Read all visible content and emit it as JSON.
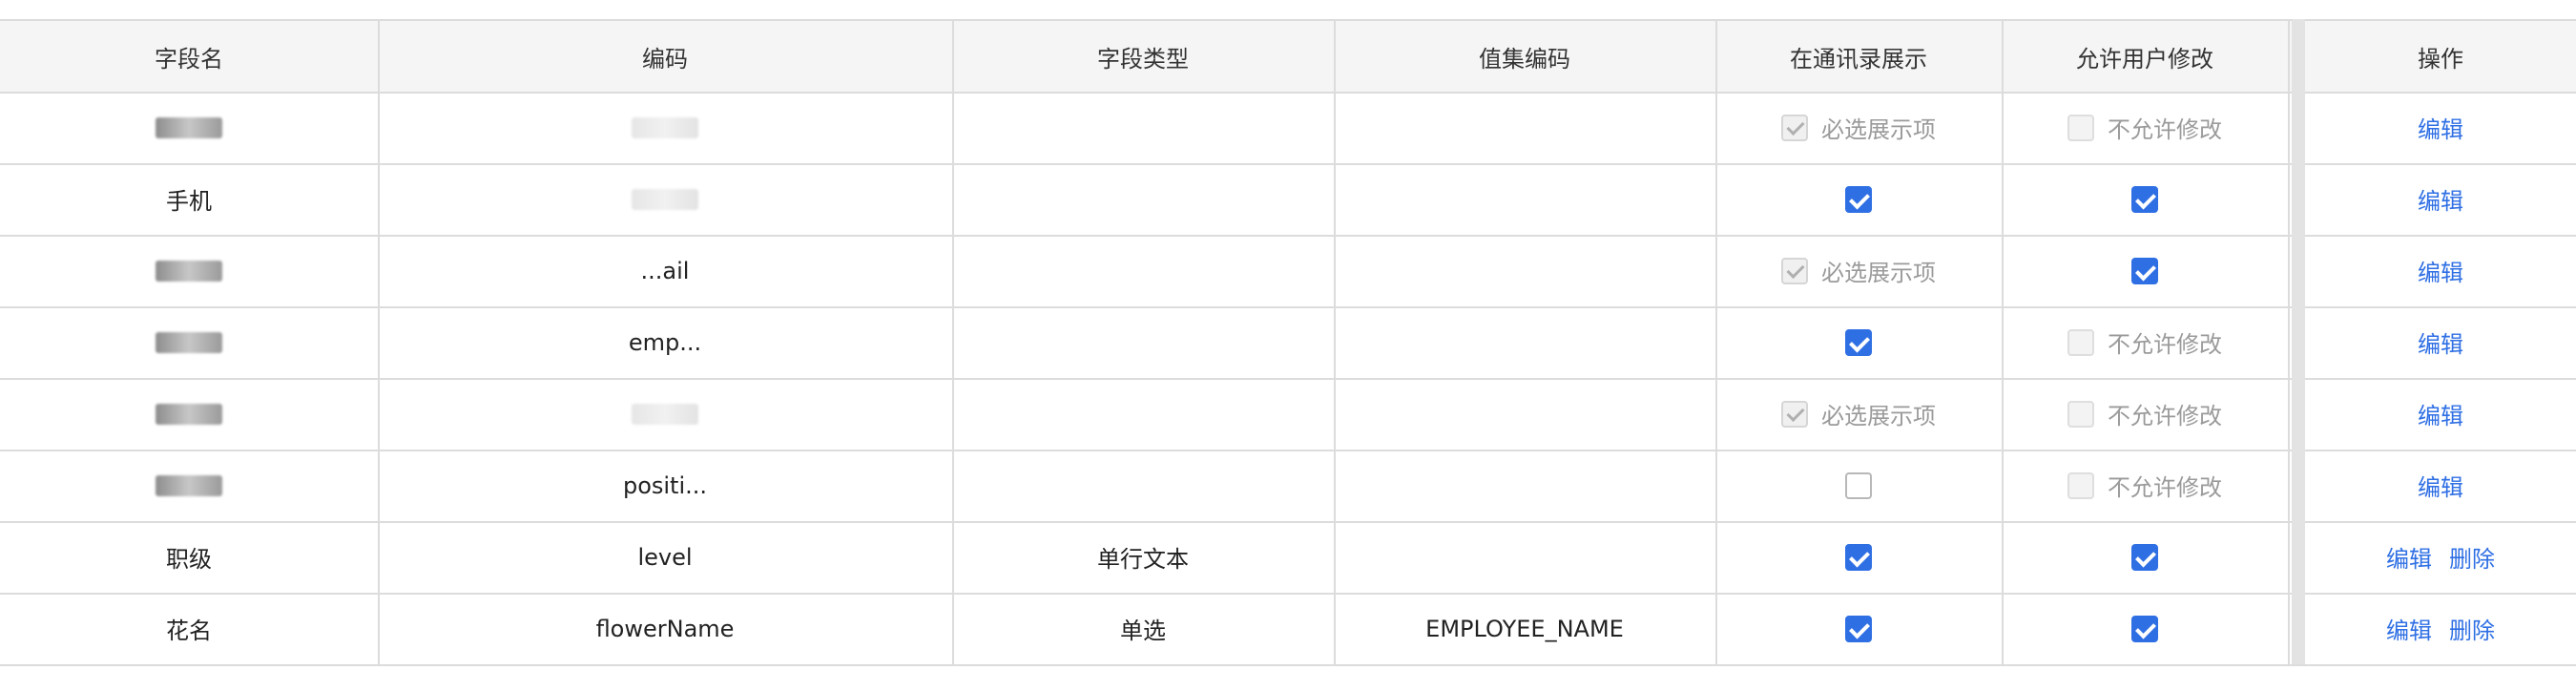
{
  "columns": [
    "字段名",
    "编码",
    "字段类型",
    "值集编码",
    "在通讯录展示",
    "允许用户修改",
    "操作"
  ],
  "labels": {
    "required_show": "必选展示项",
    "not_editable": "不允许修改",
    "edit": "编辑",
    "delete": "删除"
  },
  "rows": [
    {
      "name": "",
      "code": "",
      "type": "",
      "valueset": "",
      "show": "required",
      "modify": "disabled",
      "actions": [
        "编辑"
      ]
    },
    {
      "name": "手机",
      "code": "",
      "type": "",
      "valueset": "",
      "show": "checked",
      "modify": "checked",
      "actions": [
        "编辑"
      ]
    },
    {
      "name": "",
      "code": "...ail",
      "type": "",
      "valueset": "",
      "show": "required",
      "modify": "checked",
      "actions": [
        "编辑"
      ]
    },
    {
      "name": "",
      "code": "emp...",
      "type": "",
      "valueset": "",
      "show": "checked",
      "modify": "disabled",
      "actions": [
        "编辑"
      ]
    },
    {
      "name": "",
      "code": "",
      "type": "",
      "valueset": "",
      "show": "required",
      "modify": "disabled",
      "actions": [
        "编辑"
      ]
    },
    {
      "name": "",
      "code": "positi...",
      "type": "",
      "valueset": "",
      "show": "unchecked",
      "modify": "disabled",
      "actions": [
        "编辑"
      ]
    },
    {
      "name": "职级",
      "code": "level",
      "type": "单行文本",
      "valueset": "",
      "show": "checked",
      "modify": "checked",
      "actions": [
        "编辑",
        "删除"
      ]
    },
    {
      "name": "花名",
      "code": "flowerName",
      "type": "单选",
      "valueset": "EMPLOYEE_NAME",
      "show": "checked",
      "modify": "checked",
      "actions": [
        "编辑",
        "删除"
      ]
    }
  ]
}
